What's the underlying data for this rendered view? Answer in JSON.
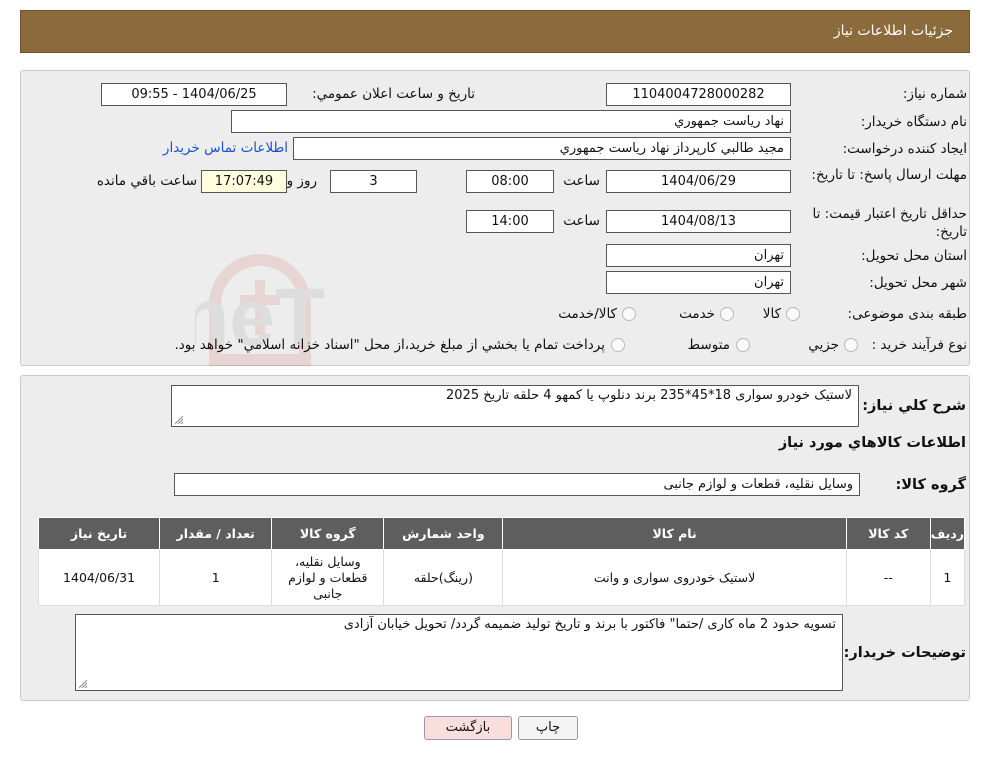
{
  "header": {
    "title": "جزئیات اطلاعات نیاز"
  },
  "fields": {
    "need_number_label": "شماره نیاز:",
    "need_number": "1104004728000282",
    "announce_label": "تاریخ و ساعت اعلان عمومي:",
    "announce_value": "1404/06/25 - 09:55",
    "buyer_org_label": "نام دستگاه خريدار:",
    "buyer_org": "نهاد رياست جمهوري",
    "creator_label": "ايجاد کننده درخواست:",
    "creator": "مجيد طالبي کارپرداز نهاد رياست جمهوري",
    "contact_link": "اطلاعات تماس خريدار",
    "deadline_label": "مهلت ارسال پاسخ: تا تاريخ:",
    "deadline_date": "1404/06/29",
    "time_word": "ساعت",
    "deadline_time": "08:00",
    "days_remaining": "3",
    "days_word": "روز و",
    "countdown": "17:07:49",
    "remaining_word": "ساعت باقي مانده",
    "validity_label": "حداقل تاريخ اعتبار قيمت: تا تاريخ:",
    "validity_date": "1404/08/13",
    "validity_time": "14:00",
    "province_label": "استان محل تحويل:",
    "province": "تهران",
    "city_label": "شهر محل تحويل:",
    "city": "تهران",
    "category_label": "طبقه بندی موضوعی:",
    "category_options": [
      "کالا",
      "خدمت",
      "کالا/خدمت"
    ],
    "process_label": "نوع فرآيند خريد :",
    "process_options": [
      "جزيي",
      "متوسط"
    ],
    "process_note": "پرداخت تمام يا بخشي از مبلغ خريد،از محل \"اسناد خزانه اسلامي\" خواهد بود."
  },
  "description": {
    "label": "شرح كلي نياز:",
    "text": "لاستیک خودرو سواری 18*45*235 برند دنلوپ یا کمهو   4 حلقه تاریخ 2025"
  },
  "goods_section_title": "اطلاعات كالاهاي مورد نياز",
  "goods_group": {
    "label": "گروه کالا:",
    "value": "وسایل نقلیه، قطعات و لوازم جانبی"
  },
  "table": {
    "headers": [
      "رديف",
      "کد کالا",
      "نام کالا",
      "واحد شمارش",
      "گروه کالا",
      "تعداد / مقدار",
      "تاريخ نياز"
    ],
    "rows": [
      {
        "row": "1",
        "code": "--",
        "name": "لاستیک خودروی سواری و وانت",
        "unit": "(رینگ)حلقه",
        "group": "وسایل نقلیه، قطعات و لوازم جانبی",
        "qty": "1",
        "date": "1404/06/31"
      }
    ]
  },
  "buyer_notes": {
    "label": "توضيحات خريدار:",
    "text": "تسویه حدود 2 ماه کاری /حتما\" فاکتور با برند و تاریخ تولید ضمیمه گردد/ تحویل خیابان آزادی"
  },
  "buttons": {
    "print": "چاپ",
    "back": "بازگشت"
  },
  "watermark": "AriaTender.neT",
  "colors": {
    "header_bg": "#8b6a3b",
    "table_header_bg": "#5e5e5e",
    "link": "#1a4fd6",
    "countdown_bg": "#ffffe0",
    "back_button_bg": "#f9dede"
  }
}
